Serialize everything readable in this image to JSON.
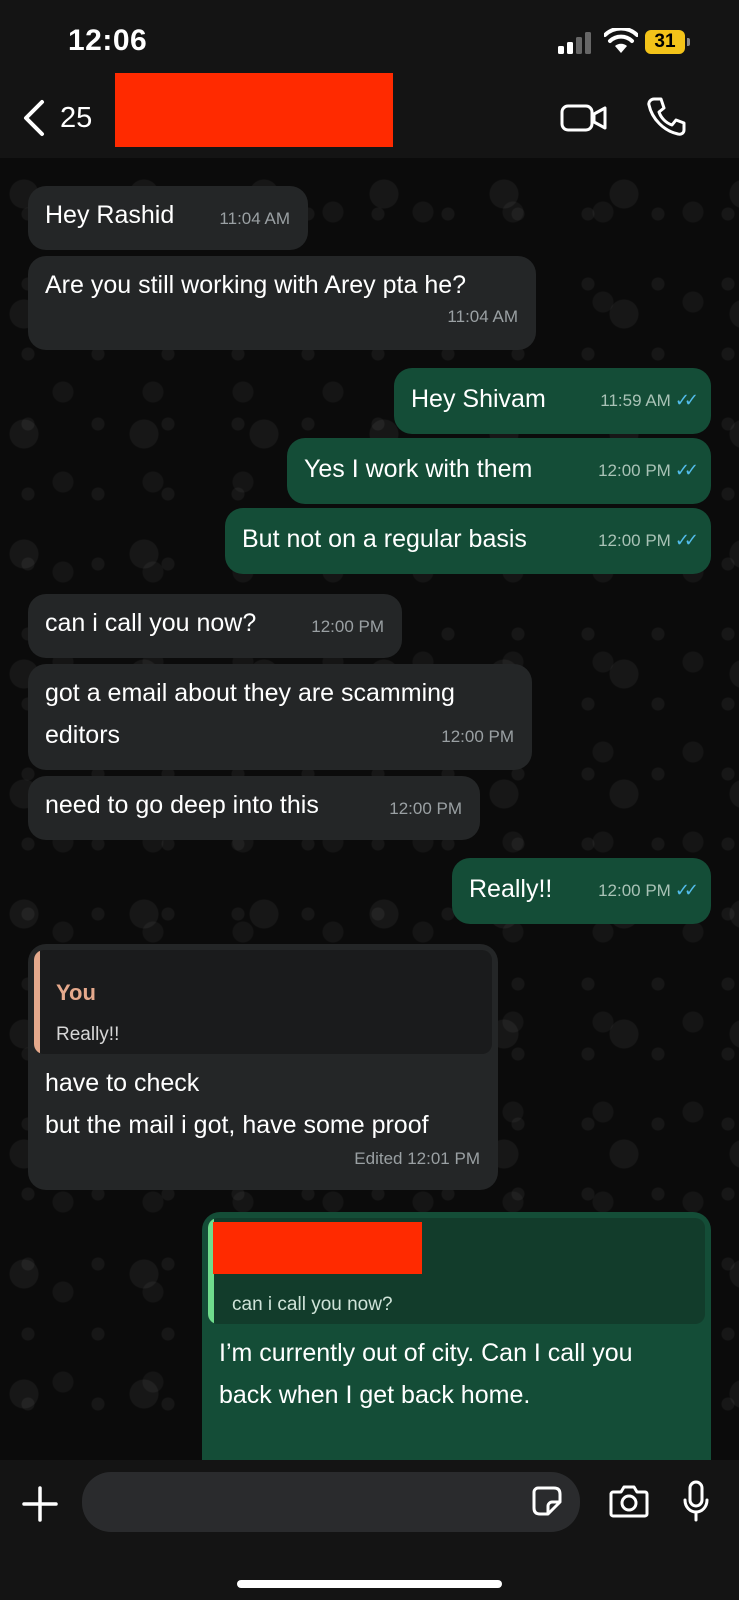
{
  "status_bar": {
    "time": "12:06",
    "battery": "31"
  },
  "header": {
    "unread_count": "25"
  },
  "messages": [
    {
      "text": "Hey Rashid",
      "time": "11:04 AM"
    },
    {
      "text": "Are you still working with Arey pta he?",
      "time": "11:04 AM"
    },
    {
      "text": "Hey Shivam",
      "time": "11:59 AM"
    },
    {
      "text": "Yes I work with them",
      "time": "12:00 PM"
    },
    {
      "text": "But not on a regular basis",
      "time": "12:00 PM"
    },
    {
      "text": "can i call you now?",
      "time": "12:00 PM"
    },
    {
      "text": "got a email about they are scamming\neditors",
      "time": "12:00 PM"
    },
    {
      "text": "need to go deep into this",
      "time": "12:00 PM"
    },
    {
      "text": "Really!!",
      "time": "12:00 PM"
    },
    {
      "quote_author": "You",
      "quote_text": "Really!!",
      "text": "have to check\nbut the mail i got, have some proof",
      "time": "Edited 12:01 PM"
    },
    {
      "quote_text": "can i call you now?",
      "text": "I’m currently out of city. Can I call you\nback when I get back home."
    }
  ],
  "colors": {
    "incoming_bubble": "#242627",
    "outgoing_bubble": "#144d37",
    "read_ticks": "#53bdeb",
    "redaction": "#ff2a00",
    "quote_you": "#e5a98c",
    "quote_other": "#6fdc8c"
  },
  "icons": [
    "back-chevron-icon",
    "video-call-icon",
    "phone-call-icon",
    "plus-icon",
    "sticker-icon",
    "camera-icon",
    "microphone-icon"
  ]
}
